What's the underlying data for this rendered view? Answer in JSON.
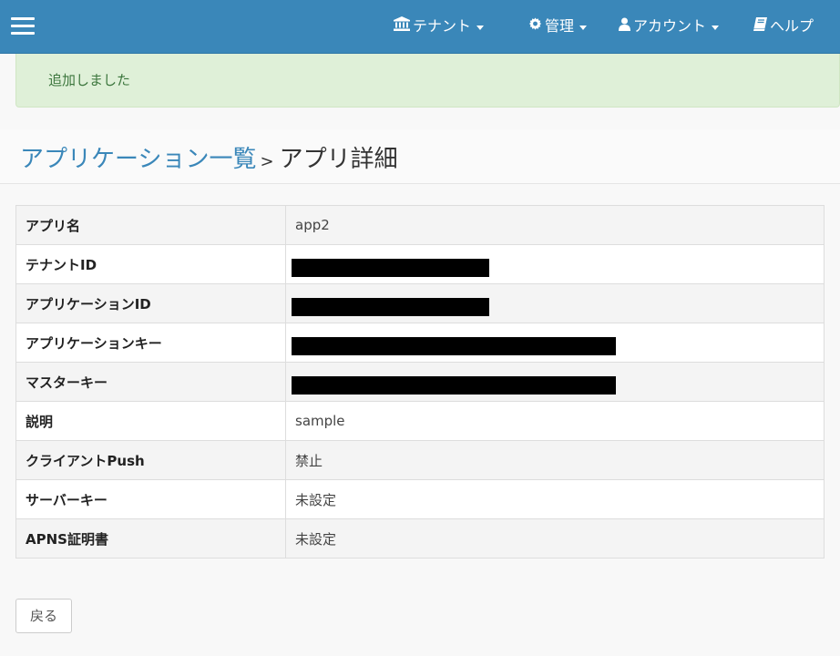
{
  "navbar": {
    "menu_icon": "hamburger-icon",
    "items": [
      {
        "label": "テナント",
        "icon": "bank-icon",
        "dropdown": true
      },
      {
        "label": "管理",
        "icon": "gear-icon",
        "dropdown": true
      },
      {
        "label": "アカウント",
        "icon": "user-icon",
        "dropdown": true
      },
      {
        "label": "ヘルプ",
        "icon": "book-icon",
        "dropdown": false
      }
    ],
    "background": "#3a87b9"
  },
  "alert": {
    "message": "追加しました",
    "color": "#dff0d8"
  },
  "breadcrumb": {
    "parent": "アプリケーション一覧",
    "separator": ">",
    "current": "アプリ詳細"
  },
  "details": {
    "rows": [
      {
        "label": "アプリ名",
        "value": "app2"
      },
      {
        "label": "テナントID",
        "value": ""
      },
      {
        "label": "アプリケーションID",
        "value": ""
      },
      {
        "label": "アプリケーションキー",
        "value": ""
      },
      {
        "label": "マスターキー",
        "value": ""
      },
      {
        "label": "説明",
        "value": "sample"
      },
      {
        "label": "クライアントPush",
        "value": "禁止"
      },
      {
        "label": "サーバーキー",
        "value": "未設定"
      },
      {
        "label": "APNS証明書",
        "value": "未設定"
      }
    ]
  },
  "back_button": {
    "label": "戻る"
  }
}
